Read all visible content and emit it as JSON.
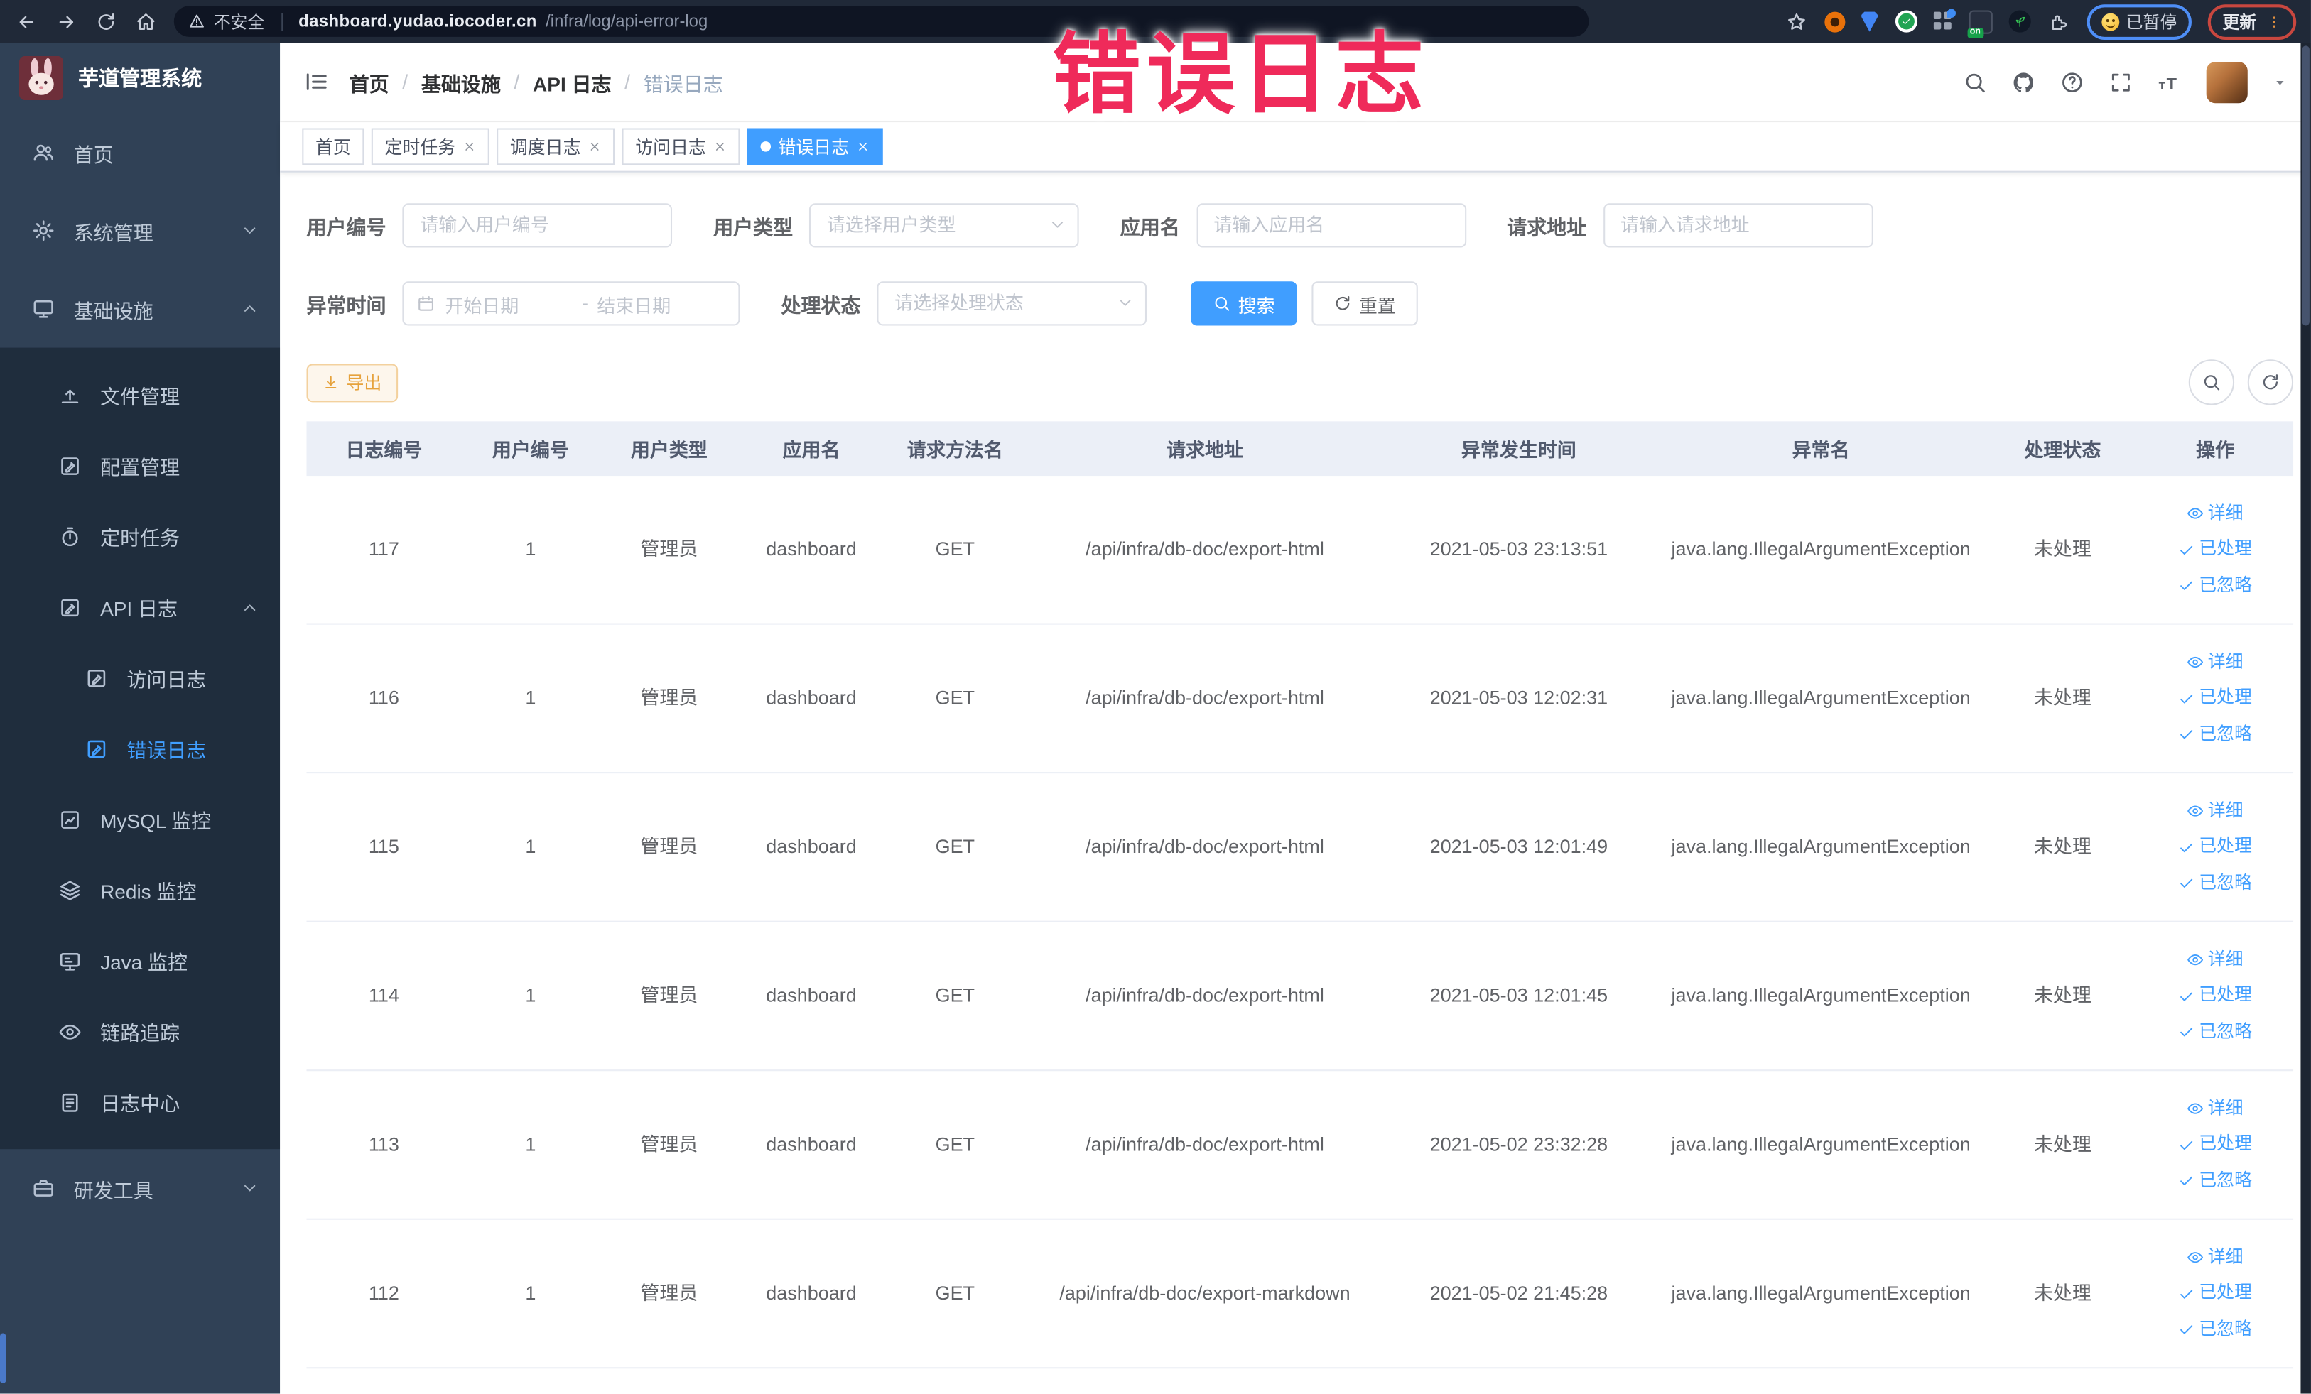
{
  "browser": {
    "security_label": "不安全",
    "url_domain": "dashboard.yudao.iocoder.cn",
    "url_path": "/infra/log/api-error-log",
    "paused_label": "已暂停",
    "update_label": "更新"
  },
  "watermark": "错误日志",
  "sidebar": {
    "title": "芋道管理系统",
    "items": [
      {
        "key": "home",
        "label": "首页",
        "icon": "users",
        "level": 0
      },
      {
        "key": "system",
        "label": "系统管理",
        "icon": "gear",
        "level": 0,
        "arrow": "down"
      },
      {
        "key": "infra",
        "label": "基础设施",
        "icon": "monitor",
        "level": 0,
        "arrow": "up"
      },
      {
        "key": "file",
        "label": "文件管理",
        "icon": "upload",
        "level": 1,
        "dark": true
      },
      {
        "key": "config",
        "label": "配置管理",
        "icon": "edit",
        "level": 1,
        "dark": true
      },
      {
        "key": "job",
        "label": "定时任务",
        "icon": "timer",
        "level": 1,
        "dark": true
      },
      {
        "key": "api-log",
        "label": "API 日志",
        "icon": "edit",
        "level": 1,
        "dark": true,
        "arrow": "up"
      },
      {
        "key": "access-log",
        "label": "访问日志",
        "icon": "edit",
        "level": 2,
        "dark": true
      },
      {
        "key": "error-log",
        "label": "错误日志",
        "icon": "edit",
        "level": 2,
        "dark": true,
        "active": true
      },
      {
        "key": "mysql",
        "label": "MySQL 监控",
        "icon": "chart",
        "level": 1,
        "dark": true
      },
      {
        "key": "redis",
        "label": "Redis 监控",
        "icon": "layers",
        "level": 1,
        "dark": true
      },
      {
        "key": "java",
        "label": "Java 监控",
        "icon": "screen",
        "level": 1,
        "dark": true
      },
      {
        "key": "tracer",
        "label": "链路追踪",
        "icon": "eye",
        "level": 1,
        "dark": true
      },
      {
        "key": "log-center",
        "label": "日志中心",
        "icon": "doc",
        "level": 1,
        "dark": true
      },
      {
        "key": "dev-tools",
        "label": "研发工具",
        "icon": "toolbox",
        "level": 0,
        "arrow": "down"
      }
    ]
  },
  "breadcrumb": [
    "首页",
    "基础设施",
    "API 日志",
    "错误日志"
  ],
  "tabs": [
    {
      "label": "首页",
      "closable": false,
      "active": false
    },
    {
      "label": "定时任务",
      "closable": true,
      "active": false
    },
    {
      "label": "调度日志",
      "closable": true,
      "active": false
    },
    {
      "label": "访问日志",
      "closable": true,
      "active": false
    },
    {
      "label": "错误日志",
      "closable": true,
      "active": true
    }
  ],
  "filters": {
    "user_id_label": "用户编号",
    "user_id_placeholder": "请输入用户编号",
    "user_type_label": "用户类型",
    "user_type_placeholder": "请选择用户类型",
    "app_name_label": "应用名",
    "app_name_placeholder": "请输入应用名",
    "request_url_label": "请求地址",
    "request_url_placeholder": "请输入请求地址",
    "exception_time_label": "异常时间",
    "start_date_placeholder": "开始日期",
    "range_separator": "-",
    "end_date_placeholder": "结束日期",
    "process_status_label": "处理状态",
    "process_status_placeholder": "请选择处理状态",
    "search_label": "搜索",
    "reset_label": "重置"
  },
  "toolbar": {
    "export_label": "导出"
  },
  "table": {
    "headers": [
      "日志编号",
      "用户编号",
      "用户类型",
      "应用名",
      "请求方法名",
      "请求地址",
      "异常发生时间",
      "异常名",
      "处理状态",
      "操作"
    ],
    "row_actions": [
      "详细",
      "已处理",
      "已忽略"
    ],
    "rows": [
      {
        "log_id": "117",
        "user_id": "1",
        "user_type": "管理员",
        "app_name": "dashboard",
        "method": "GET",
        "url": "/api/infra/db-doc/export-html",
        "time": "2021-05-03 23:13:51",
        "exception": "java.lang.IllegalArgumentException",
        "status": "未处理"
      },
      {
        "log_id": "116",
        "user_id": "1",
        "user_type": "管理员",
        "app_name": "dashboard",
        "method": "GET",
        "url": "/api/infra/db-doc/export-html",
        "time": "2021-05-03 12:02:31",
        "exception": "java.lang.IllegalArgumentException",
        "status": "未处理"
      },
      {
        "log_id": "115",
        "user_id": "1",
        "user_type": "管理员",
        "app_name": "dashboard",
        "method": "GET",
        "url": "/api/infra/db-doc/export-html",
        "time": "2021-05-03 12:01:49",
        "exception": "java.lang.IllegalArgumentException",
        "status": "未处理"
      },
      {
        "log_id": "114",
        "user_id": "1",
        "user_type": "管理员",
        "app_name": "dashboard",
        "method": "GET",
        "url": "/api/infra/db-doc/export-html",
        "time": "2021-05-03 12:01:45",
        "exception": "java.lang.IllegalArgumentException",
        "status": "未处理"
      },
      {
        "log_id": "113",
        "user_id": "1",
        "user_type": "管理员",
        "app_name": "dashboard",
        "method": "GET",
        "url": "/api/infra/db-doc/export-html",
        "time": "2021-05-02 23:32:28",
        "exception": "java.lang.IllegalArgumentException",
        "status": "未处理"
      },
      {
        "log_id": "112",
        "user_id": "1",
        "user_type": "管理员",
        "app_name": "dashboard",
        "method": "GET",
        "url": "/api/infra/db-doc/export-markdown",
        "time": "2021-05-02 21:45:28",
        "exception": "java.lang.IllegalArgumentException",
        "status": "未处理"
      }
    ]
  },
  "colors": {
    "accent": "#409EFF",
    "sidebar_bg": "#304156",
    "submenu_bg": "#1f2d3d",
    "active_tab_bg": "#409EFF",
    "watermark": "#ef2a5a",
    "export_text": "#e6a23c",
    "export_bg": "#fdf6ec",
    "export_border": "#f3d19e",
    "table_header_bg": "#ebeff7",
    "browser_bar_bg": "#202938"
  }
}
